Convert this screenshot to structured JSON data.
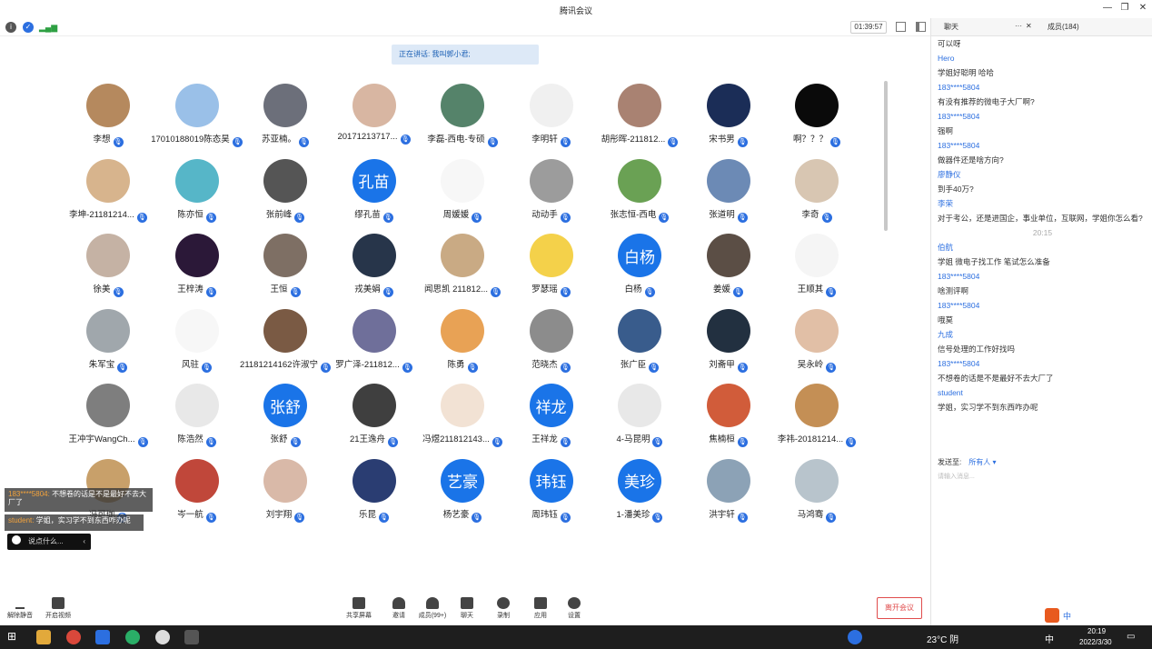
{
  "window": {
    "title": "腾讯会议"
  },
  "topbar": {
    "timer": "01:39:57"
  },
  "speaker": "正在讲话: 我叫郭小君;",
  "participants": [
    {
      "name": "李想",
      "bg": "#b5895e",
      "text": ""
    },
    {
      "name": "17010188019陈态昊",
      "bg": "#9ac0e8",
      "text": ""
    },
    {
      "name": "苏亚楠。",
      "bg": "#6c6f7a",
      "text": ""
    },
    {
      "name": "20171213717...",
      "bg": "#d8b6a2",
      "text": ""
    },
    {
      "name": "李磊-西电-专硕",
      "bg": "#55836a",
      "text": ""
    },
    {
      "name": "李明轩",
      "bg": "#f0f0f0",
      "text": ""
    },
    {
      "name": "胡彤晖-211812...",
      "bg": "#a98272",
      "text": ""
    },
    {
      "name": "宋书男",
      "bg": "#1b2d57",
      "text": ""
    },
    {
      "name": "啊？？？",
      "bg": "#0a0a0a",
      "text": ""
    },
    {
      "name": "李坤-21181214...",
      "bg": "#d7b48d",
      "text": ""
    },
    {
      "name": "陈亦恒",
      "bg": "#56b6c8",
      "text": ""
    },
    {
      "name": "张前峰",
      "bg": "#555555",
      "text": ""
    },
    {
      "name": "缪孔苗",
      "bg": "#1a74e8",
      "text": "孔苗"
    },
    {
      "name": "周媛媛",
      "bg": "#f7f7f7",
      "text": ""
    },
    {
      "name": "动动手",
      "bg": "#9c9c9c",
      "text": ""
    },
    {
      "name": "张志恒-西电",
      "bg": "#6aa154",
      "text": ""
    },
    {
      "name": "张道明",
      "bg": "#6c8ab5",
      "text": ""
    },
    {
      "name": "李奇",
      "bg": "#d8c6b2",
      "text": ""
    },
    {
      "name": "徐美",
      "bg": "#c5b2a4",
      "text": ""
    },
    {
      "name": "王梓涛",
      "bg": "#2b1838",
      "text": ""
    },
    {
      "name": "王恒",
      "bg": "#7e6f64",
      "text": ""
    },
    {
      "name": "戎美娟",
      "bg": "#27354a",
      "text": ""
    },
    {
      "name": "闻思凯 211812...",
      "bg": "#c9aa84",
      "text": ""
    },
    {
      "name": "罗瑟瑶",
      "bg": "#f4d14a",
      "text": ""
    },
    {
      "name": "白杨",
      "bg": "#1a74e8",
      "text": "白杨"
    },
    {
      "name": "姜媛",
      "bg": "#5b4e45",
      "text": ""
    },
    {
      "name": "王顺其",
      "bg": "#f5f5f5",
      "text": ""
    },
    {
      "name": "朱军宝",
      "bg": "#a0a7ac",
      "text": ""
    },
    {
      "name": "风驻",
      "bg": "#f7f7f7",
      "text": ""
    },
    {
      "name": "21181214162许淑宁",
      "bg": "#7a5a44",
      "text": ""
    },
    {
      "name": "罗广泽-211812...",
      "bg": "#6f6f9a",
      "text": ""
    },
    {
      "name": "陈勇",
      "bg": "#e8a255",
      "text": ""
    },
    {
      "name": "范晓杰",
      "bg": "#8c8c8c",
      "text": ""
    },
    {
      "name": "张广臣",
      "bg": "#395c8c",
      "text": ""
    },
    {
      "name": "刘斋甲",
      "bg": "#223040",
      "text": ""
    },
    {
      "name": "吴永岭",
      "bg": "#e1bfa6",
      "text": ""
    },
    {
      "name": "王冲宇WangCh...",
      "bg": "#7e7e7e",
      "text": ""
    },
    {
      "name": "陈浩然",
      "bg": "#e8e8e8",
      "text": ""
    },
    {
      "name": "张舒",
      "bg": "#1a74e8",
      "text": "张舒"
    },
    {
      "name": "21王逸舟",
      "bg": "#3f3f3f",
      "text": ""
    },
    {
      "name": "冯煜211812143...",
      "bg": "#f2e2d4",
      "text": ""
    },
    {
      "name": "王祥龙",
      "bg": "#1a74e8",
      "text": "祥龙"
    },
    {
      "name": "4-马昆明",
      "bg": "#e8e8e8",
      "text": ""
    },
    {
      "name": "焦楠桓",
      "bg": "#d15c3a",
      "text": ""
    },
    {
      "name": "李祎-20181214...",
      "bg": "#c48f55",
      "text": ""
    },
    {
      "name": "冯可珈",
      "bg": "#c8a06a",
      "text": ""
    },
    {
      "name": "岑一航",
      "bg": "#c0473a",
      "text": ""
    },
    {
      "name": "刘宇翔",
      "bg": "#d9b9a8",
      "text": ""
    },
    {
      "name": "乐昆",
      "bg": "#2a3d72",
      "text": ""
    },
    {
      "name": "杨艺豪",
      "bg": "#1a74e8",
      "text": "艺豪"
    },
    {
      "name": "周玮钰",
      "bg": "#1a74e8",
      "text": "玮钰"
    },
    {
      "name": "1-潘美珍",
      "bg": "#1a74e8",
      "text": "美珍"
    },
    {
      "name": "洪宇轩",
      "bg": "#8ca2b6",
      "text": ""
    },
    {
      "name": "马鸿骞",
      "bg": "#b8c4cc",
      "text": ""
    }
  ],
  "chat_banner": [
    {
      "who": "183****5804:",
      "msg": "不想卷的话是不是最好不去大厂了"
    },
    {
      "who": "student:",
      "msg": "学姐，实习学不到东西咋办呢"
    }
  ],
  "chat_input": "说点什么...",
  "toolbar": {
    "mute": "解除静音",
    "video": "开启视频",
    "share": "共享屏幕",
    "invite": "邀请",
    "members": "成员(99+)",
    "chat": "聊天",
    "record": "录制",
    "apps": "应用",
    "settings": "设置",
    "leave": "离开会议"
  },
  "sidebar": {
    "tab_chat": "聊天",
    "tab_members": "成员(184)",
    "messages": [
      {
        "t": "msg",
        "v": "可以呀"
      },
      {
        "t": "sender",
        "v": "Hero"
      },
      {
        "t": "msg",
        "v": "学姐好聪明 哈哈"
      },
      {
        "t": "sender",
        "v": "183****5804"
      },
      {
        "t": "msg",
        "v": "有没有推荐的微电子大厂啊?"
      },
      {
        "t": "sender",
        "v": "183****5804"
      },
      {
        "t": "msg",
        "v": "强啊"
      },
      {
        "t": "sender",
        "v": "183****5804"
      },
      {
        "t": "msg",
        "v": "做器件还是啥方向?"
      },
      {
        "t": "sender",
        "v": "廖静仪"
      },
      {
        "t": "msg",
        "v": "到手40万?"
      },
      {
        "t": "sender",
        "v": "李荣"
      },
      {
        "t": "msg",
        "v": "对于考公，还是进国企，事业单位，互联网，学姐你怎么看?"
      },
      {
        "t": "time",
        "v": "20:15"
      },
      {
        "t": "sender",
        "v": "伯航"
      },
      {
        "t": "msg",
        "v": "学姐 微电子找工作 笔试怎么准备"
      },
      {
        "t": "sender",
        "v": "183****5804"
      },
      {
        "t": "msg",
        "v": "啥测评啊"
      },
      {
        "t": "sender",
        "v": "183****5804"
      },
      {
        "t": "msg",
        "v": "哦莫"
      },
      {
        "t": "sender",
        "v": "九成"
      },
      {
        "t": "msg",
        "v": "信号处理的工作好找吗"
      },
      {
        "t": "sender",
        "v": "183****5804"
      },
      {
        "t": "msg",
        "v": "不想卷的话是不是最好不去大厂了"
      },
      {
        "t": "sender",
        "v": "student"
      },
      {
        "t": "msg",
        "v": "学姐，实习学不到东西咋办呢"
      }
    ],
    "send_to_label": "发送至:",
    "send_to_value": "所有人 ▾",
    "input_placeholder": "请输入消息..."
  },
  "taskbar": {
    "weather": "23°C 阴",
    "ime": "中",
    "time": "20:19",
    "date": "2022/3/30"
  }
}
